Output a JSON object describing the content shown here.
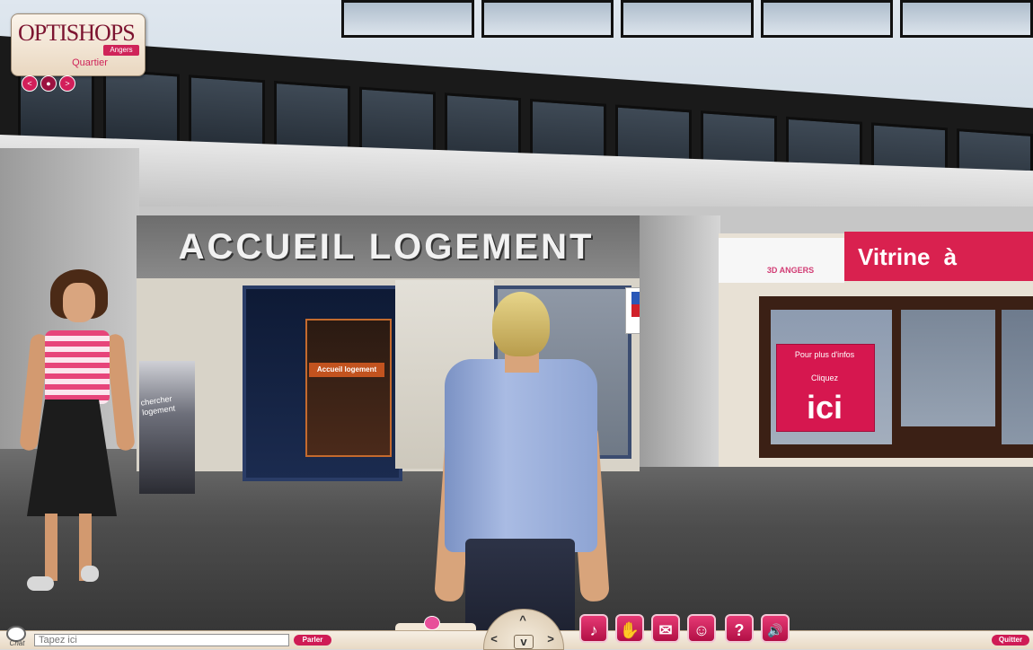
{
  "logo": {
    "brand": "OPTISHOPS",
    "city": "Angers",
    "subtitle": "Quartier",
    "nav": {
      "prev": "<",
      "home": "●",
      "next": ">"
    }
  },
  "scene": {
    "shop_sign": "ACCUEIL LOGEMENT",
    "poster_title": "Accueil logement",
    "vitrine_logo": "3D ANGERS",
    "vitrine_banner": "Vitrine à",
    "promo": {
      "line1": "Pour plus d'infos",
      "line2": "Cliquez",
      "big": "ici"
    },
    "side_banner": "chercher logement"
  },
  "bottom_bar": {
    "chat_label": "Chat",
    "chat_placeholder": "Tapez ici",
    "speak_button": "Parler",
    "quit_button": "Quitter",
    "arrows": {
      "up": "^",
      "left": "<",
      "down": "v",
      "right": ">"
    },
    "tools": [
      {
        "icon": "music-icon",
        "glyph": "♪"
      },
      {
        "icon": "gestures-icon",
        "glyph": "✋"
      },
      {
        "icon": "chat-bubbles-icon",
        "glyph": "✉"
      },
      {
        "icon": "profile-icon",
        "glyph": "☺"
      },
      {
        "icon": "help-icon",
        "glyph": "?"
      },
      {
        "icon": "sound-icon",
        "glyph": "🔊"
      }
    ]
  },
  "colors": {
    "accent": "#cf1b55",
    "vitrine_red": "#d9214f"
  }
}
